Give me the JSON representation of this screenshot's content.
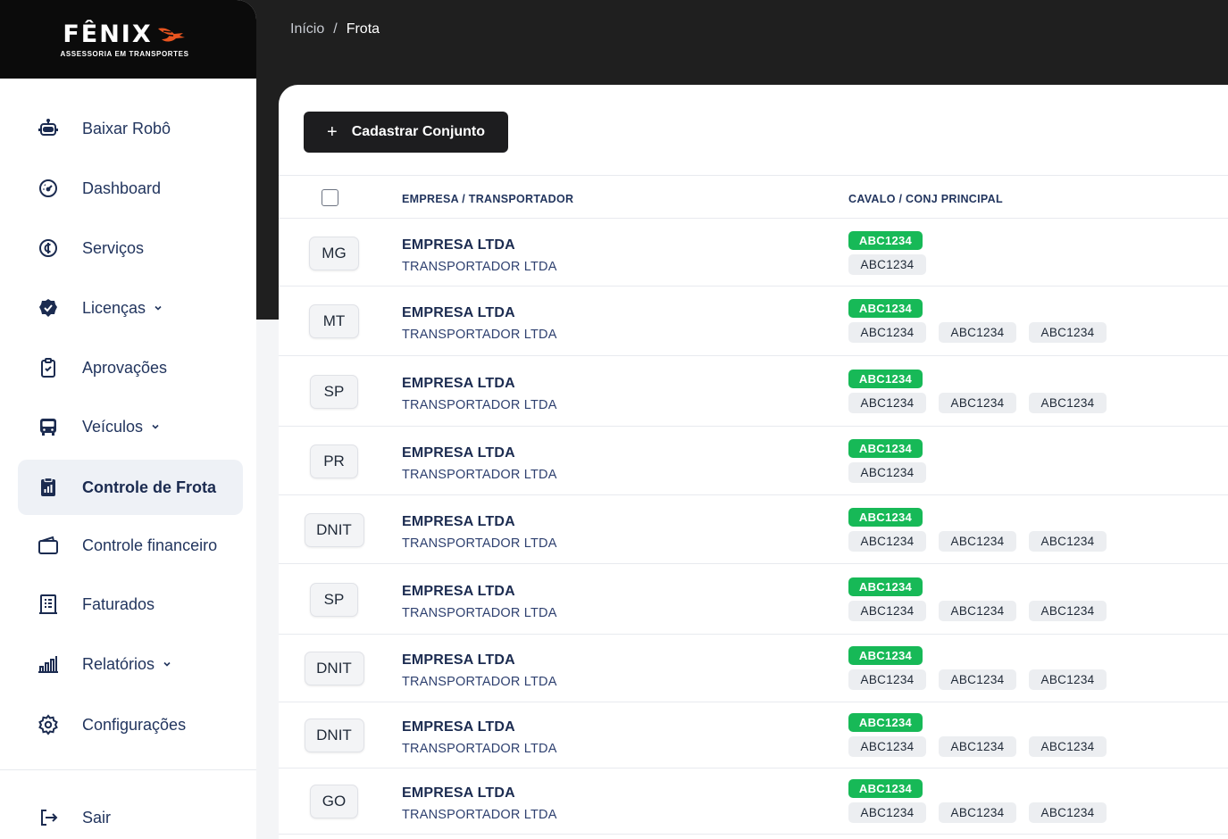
{
  "brand": {
    "name": "FÊNIX",
    "tagline": "ASSESSORIA EM TRANSPORTES",
    "accent": "#e8541f"
  },
  "breadcrumb": {
    "home": "Início",
    "separator": "/",
    "current": "Frota"
  },
  "sidebar": {
    "items": [
      {
        "label": "Baixar Robô",
        "icon": "robot-icon",
        "has_chevron": false,
        "active": false
      },
      {
        "label": "Dashboard",
        "icon": "gauge-icon",
        "has_chevron": false,
        "active": false
      },
      {
        "label": "Serviços",
        "icon": "services-icon",
        "has_chevron": false,
        "active": false
      },
      {
        "label": "Licenças",
        "icon": "badge-check-icon",
        "has_chevron": true,
        "active": false
      },
      {
        "label": "Aprovações",
        "icon": "clipboard-check-icon",
        "has_chevron": false,
        "active": false
      },
      {
        "label": "Veículos",
        "icon": "bus-icon",
        "has_chevron": true,
        "active": false
      },
      {
        "label": "Controle de Frota",
        "icon": "fleet-report-icon",
        "has_chevron": false,
        "active": true
      },
      {
        "label": "Controle financeiro",
        "icon": "wallet-icon",
        "has_chevron": false,
        "active": false
      },
      {
        "label": "Faturados",
        "icon": "invoice-icon",
        "has_chevron": false,
        "active": false
      },
      {
        "label": "Relatórios",
        "icon": "bar-chart-icon",
        "has_chevron": true,
        "active": false
      },
      {
        "label": "Configurações",
        "icon": "gear-icon",
        "has_chevron": false,
        "active": false
      }
    ],
    "logout": {
      "label": "Sair",
      "icon": "logout-icon"
    }
  },
  "toolbar": {
    "add_label": "Cadastrar Conjunto"
  },
  "table": {
    "columns": [
      "EMPRESA / TRANSPORTADOR",
      "CAVALO / CONJ PRINCIPAL"
    ],
    "rows": [
      {
        "state": "MG",
        "company": "EMPRESA LTDA",
        "carrier": "TRANSPORTADOR LTDA",
        "main_plate": "ABC1234",
        "plates": [
          "ABC1234"
        ]
      },
      {
        "state": "MT",
        "company": "EMPRESA LTDA",
        "carrier": "TRANSPORTADOR LTDA",
        "main_plate": "ABC1234",
        "plates": [
          "ABC1234",
          "ABC1234",
          "ABC1234"
        ]
      },
      {
        "state": "SP",
        "company": "EMPRESA LTDA",
        "carrier": "TRANSPORTADOR LTDA",
        "main_plate": "ABC1234",
        "plates": [
          "ABC1234",
          "ABC1234",
          "ABC1234"
        ]
      },
      {
        "state": "PR",
        "company": "EMPRESA LTDA",
        "carrier": "TRANSPORTADOR LTDA",
        "main_plate": "ABC1234",
        "plates": [
          "ABC1234"
        ]
      },
      {
        "state": "DNIT",
        "company": "EMPRESA LTDA",
        "carrier": "TRANSPORTADOR LTDA",
        "main_plate": "ABC1234",
        "plates": [
          "ABC1234",
          "ABC1234",
          "ABC1234"
        ]
      },
      {
        "state": "SP",
        "company": "EMPRESA LTDA",
        "carrier": "TRANSPORTADOR LTDA",
        "main_plate": "ABC1234",
        "plates": [
          "ABC1234",
          "ABC1234",
          "ABC1234"
        ]
      },
      {
        "state": "DNIT",
        "company": "EMPRESA LTDA",
        "carrier": "TRANSPORTADOR LTDA",
        "main_plate": "ABC1234",
        "plates": [
          "ABC1234",
          "ABC1234",
          "ABC1234"
        ]
      },
      {
        "state": "DNIT",
        "company": "EMPRESA LTDA",
        "carrier": "TRANSPORTADOR LTDA",
        "main_plate": "ABC1234",
        "plates": [
          "ABC1234",
          "ABC1234",
          "ABC1234"
        ]
      },
      {
        "state": "GO",
        "company": "EMPRESA LTDA",
        "carrier": "TRANSPORTADOR LTDA",
        "main_plate": "ABC1234",
        "plates": [
          "ABC1234",
          "ABC1234",
          "ABC1234"
        ]
      }
    ]
  }
}
